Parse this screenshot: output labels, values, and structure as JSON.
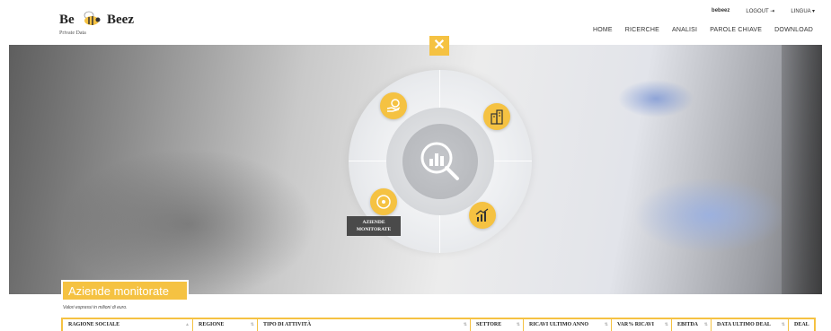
{
  "logo": {
    "be": "Be",
    "beez": "Beez",
    "sub": "Private Data",
    "icon": "bee-icon"
  },
  "toplinks": {
    "user": "bebeez",
    "logout": "LOGOUT ⇥",
    "lingua": "LINGUA ▾"
  },
  "nav": [
    "HOME",
    "RICERCHE",
    "ANALISI",
    "PAROLE CHIAVE",
    "DOWNLOAD"
  ],
  "menu": {
    "close": "✕",
    "tooltip_line1": "AZIENDE",
    "tooltip_line2": "MONITORATE",
    "icons": [
      "hand-coin-icon",
      "buildings-icon",
      "cycle-arrows-icon",
      "growth-chart-icon",
      "search-chart-icon"
    ]
  },
  "section": {
    "title": "Aziende monitorate",
    "note": "Valori espressi in milioni di euro."
  },
  "table": {
    "columns": [
      "RAGIONE SOCIALE",
      "REGIONE",
      "TIPO DI ATTIVITÀ",
      "SETTORE",
      "RICAVI ULTIMO ANNO",
      "VAR% RICAVI",
      "EBITDA",
      "DATA ULTIMO DEAL",
      "DEAL"
    ]
  },
  "colors": {
    "accent": "#f5c242"
  }
}
